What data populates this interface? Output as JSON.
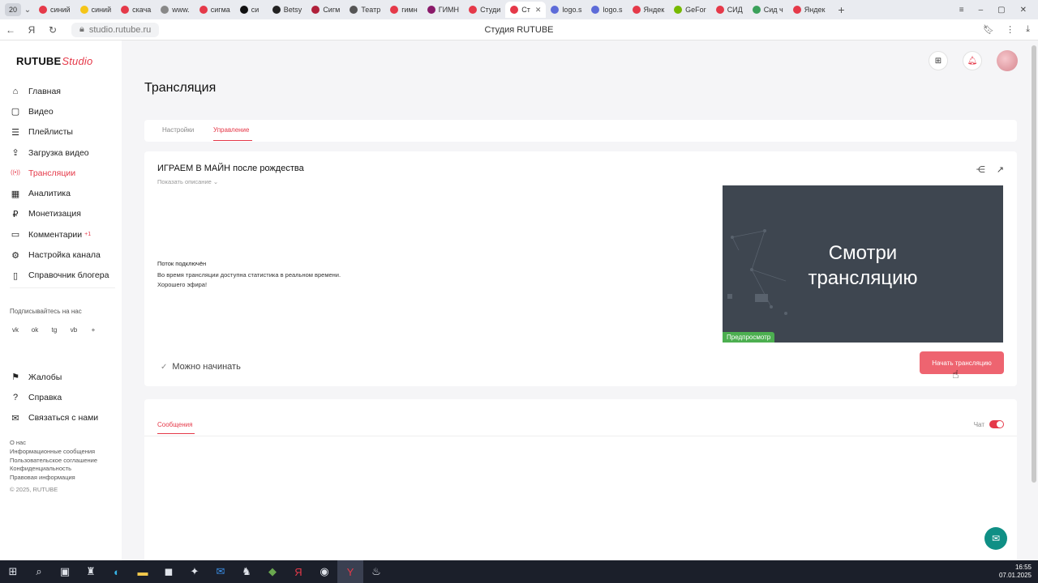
{
  "browser": {
    "tab_count": "20",
    "tabs": [
      {
        "label": "синий",
        "color": "#e53949"
      },
      {
        "label": "синий",
        "color": "#f5c518"
      },
      {
        "label": "скача",
        "color": "#e53949"
      },
      {
        "label": "www.",
        "color": "#888888"
      },
      {
        "label": "сигма",
        "color": "#e53949"
      },
      {
        "label": "си",
        "color": "#111111"
      },
      {
        "label": "Betsy",
        "color": "#222222"
      },
      {
        "label": "Сигм",
        "color": "#b0203a"
      },
      {
        "label": "Театр",
        "color": "#555555"
      },
      {
        "label": "гимн",
        "color": "#e53949"
      },
      {
        "label": "ГИМН",
        "color": "#8a1a6a"
      },
      {
        "label": "Студи",
        "color": "#e53949"
      },
      {
        "label": "Ст",
        "color": "#e53949",
        "active": true
      },
      {
        "label": "logo.s",
        "color": "#5d6bd8"
      },
      {
        "label": "logo.s",
        "color": "#5d6bd8"
      },
      {
        "label": "Яндек",
        "color": "#e53949"
      },
      {
        "label": "GeFor",
        "color": "#76b900"
      },
      {
        "label": "СИД",
        "color": "#e53949"
      },
      {
        "label": "Сид ч",
        "color": "#3aa05a"
      },
      {
        "label": "Яндек",
        "color": "#e53949"
      }
    ],
    "url": "studio.rutube.ru",
    "page_title": "Студия RUTUBE"
  },
  "sidebar": {
    "logo_main": "RUTUBE",
    "logo_studio": "Studio",
    "items": [
      {
        "label": "Главная",
        "icon": "⌂"
      },
      {
        "label": "Видео",
        "icon": "▢"
      },
      {
        "label": "Плейлисты",
        "icon": "☰"
      },
      {
        "label": "Загрузка видео",
        "icon": "⇪"
      },
      {
        "label": "Трансляции",
        "icon": "((•))",
        "active": true
      },
      {
        "label": "Аналитика",
        "icon": "▦"
      },
      {
        "label": "Монетизация",
        "icon": "₽"
      },
      {
        "label": "Комментарии",
        "icon": "▭",
        "badge": "+1"
      },
      {
        "label": "Настройка канала",
        "icon": "⚙"
      },
      {
        "label": "Справочник блогера",
        "icon": "▯"
      }
    ],
    "subscribe_label": "Подписывайтесь на нас",
    "socials": [
      "vk",
      "ok",
      "tg",
      "vb",
      "+"
    ],
    "items2": [
      {
        "label": "Жалобы",
        "icon": "⚑"
      },
      {
        "label": "Справка",
        "icon": "?"
      },
      {
        "label": "Связаться с нами",
        "icon": "✉"
      }
    ],
    "footer": [
      "О нас",
      "Информационные сообщения",
      "Пользовательское соглашение",
      "Конфиденциальность",
      "Правовая информация"
    ],
    "copyright": "© 2025, RUTUBE"
  },
  "main": {
    "title": "Трансляция",
    "tabs": [
      "Настройки",
      "Управление"
    ],
    "active_tab": "Управление",
    "stream": {
      "title": "ИГРАЕМ В МАЙН после рождества",
      "show_description": "Показать описание",
      "status_head": "Поток подключён",
      "status_line1": "Во время трансляции доступна статистика в реальном времени.",
      "status_line2": "Хорошего эфира!",
      "ready_label": "Можно начинать",
      "preview_line1": "Смотри",
      "preview_line2": "трансляцию",
      "preview_badge": "Предпросмотр",
      "start_button": "Начать трансляцию"
    },
    "chat": {
      "tab_label": "Сообщения",
      "toggle_label": "Чат",
      "toggle_on": true
    }
  },
  "taskbar": {
    "time": "16:55",
    "date": "07.01.2025"
  },
  "colors": {
    "accent": "#e53949",
    "start_button": "#ee6470",
    "preview_bg": "#3e4650",
    "preview_badge": "#4caf50",
    "help_fab": "#0f8f85"
  }
}
